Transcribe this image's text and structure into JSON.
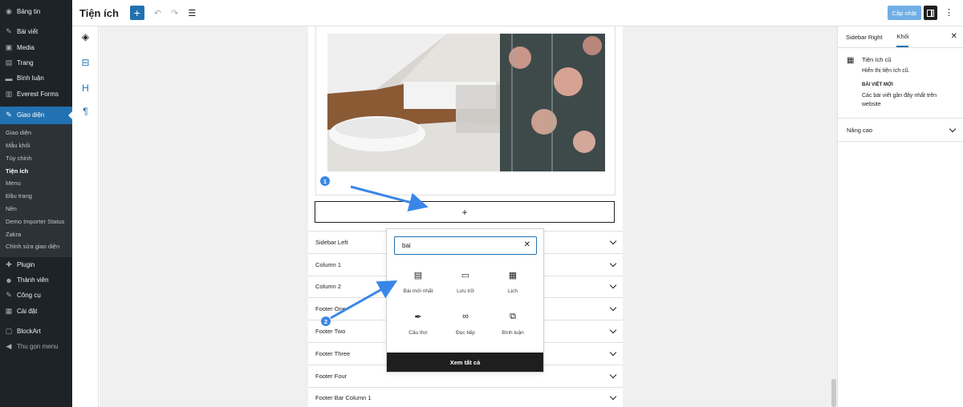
{
  "admin_menu": {
    "items_top": [
      {
        "label": "Bảng tin",
        "icon": "dashboard-icon",
        "glyph": "◉"
      },
      {
        "label": "Bài viết",
        "icon": "pin-icon",
        "glyph": "✎"
      },
      {
        "label": "Media",
        "icon": "media-icon",
        "glyph": "▣"
      },
      {
        "label": "Trang",
        "icon": "page-icon",
        "glyph": "▤"
      },
      {
        "label": "Bình luận",
        "icon": "comment-icon",
        "glyph": "▬"
      },
      {
        "label": "Everest Forms",
        "icon": "form-icon",
        "glyph": "▥"
      }
    ],
    "active": {
      "label": "Giao diện",
      "icon": "brush-icon",
      "glyph": "✎"
    },
    "submenu": [
      "Giao diện",
      "Mẫu khối",
      "Tùy chỉnh",
      "Tiện ích",
      "Menu",
      "Đầu trang",
      "Nền",
      "Demo Importer Status",
      "Zakra",
      "Chỉnh sửa giao diện"
    ],
    "submenu_current": "Tiện ích",
    "items_bottom": [
      {
        "label": "Plugin",
        "icon": "plugin-icon",
        "glyph": "✚"
      },
      {
        "label": "Thành viên",
        "icon": "users-icon",
        "glyph": "☻"
      },
      {
        "label": "Công cụ",
        "icon": "tools-icon",
        "glyph": "✎"
      },
      {
        "label": "Cài đặt",
        "icon": "settings-icon",
        "glyph": "▦"
      }
    ],
    "blockart": {
      "label": "BlockArt",
      "icon": "blockart-icon",
      "glyph": "▢"
    },
    "collapse": {
      "label": "Thu gọn menu",
      "icon": "collapse-icon",
      "glyph": "◀"
    }
  },
  "topbar": {
    "title": "Tiện ích",
    "add_icon": "+",
    "undo_icon": "↶",
    "redo_icon": "↷",
    "list_view_icon": "☰",
    "update_label": "Cập nhật",
    "more_icon": "⋮"
  },
  "toolstrip": {
    "tools": [
      {
        "name": "layers-icon",
        "glyph": "◈"
      },
      {
        "name": "widget-block-icon",
        "glyph": "⊟"
      },
      {
        "name": "heading-icon",
        "glyph": "H"
      },
      {
        "name": "paragraph-icon",
        "glyph": "¶"
      }
    ]
  },
  "canvas": {
    "add_block_icon": "+",
    "areas": [
      "Sidebar Left",
      "Column 1",
      "Column 2",
      "Footer One",
      "Footer Two",
      "Footer Three",
      "Footer Four",
      "Footer Bar Column 1"
    ],
    "badges": [
      "1",
      "2"
    ]
  },
  "inserter": {
    "search_value": "bai",
    "clear_icon": "✕",
    "results": [
      {
        "label": "Bài mới nhất",
        "icon": "latest-posts-icon",
        "glyph": "▤"
      },
      {
        "label": "Lưu trữ",
        "icon": "archive-icon",
        "glyph": "▭"
      },
      {
        "label": "Lịch",
        "icon": "calendar-icon",
        "glyph": "▦"
      },
      {
        "label": "Câu thơ",
        "icon": "verse-icon",
        "glyph": "✒"
      },
      {
        "label": "Đọc tiếp",
        "icon": "link-icon",
        "glyph": "∞"
      },
      {
        "label": "Bình luận",
        "icon": "comments-icon",
        "glyph": "⧉"
      }
    ],
    "see_all": "Xem tất cả"
  },
  "rightbar": {
    "tabs": [
      "Sidebar Right",
      "Khối"
    ],
    "active_tab": "Khối",
    "close_icon": "✕",
    "block_icon": "▦",
    "block_title": "Tiện ích cũ",
    "block_desc": "Hiển thị tiện ích cũ.",
    "variant_title": "BÀI VIẾT MỚI",
    "variant_desc": "Các bài viết gần đây nhất trên website",
    "advanced": "Nâng cao"
  },
  "colors": {
    "admin_bg": "#1d2327",
    "accent": "#2271b1",
    "badge": "#3a86e8"
  }
}
